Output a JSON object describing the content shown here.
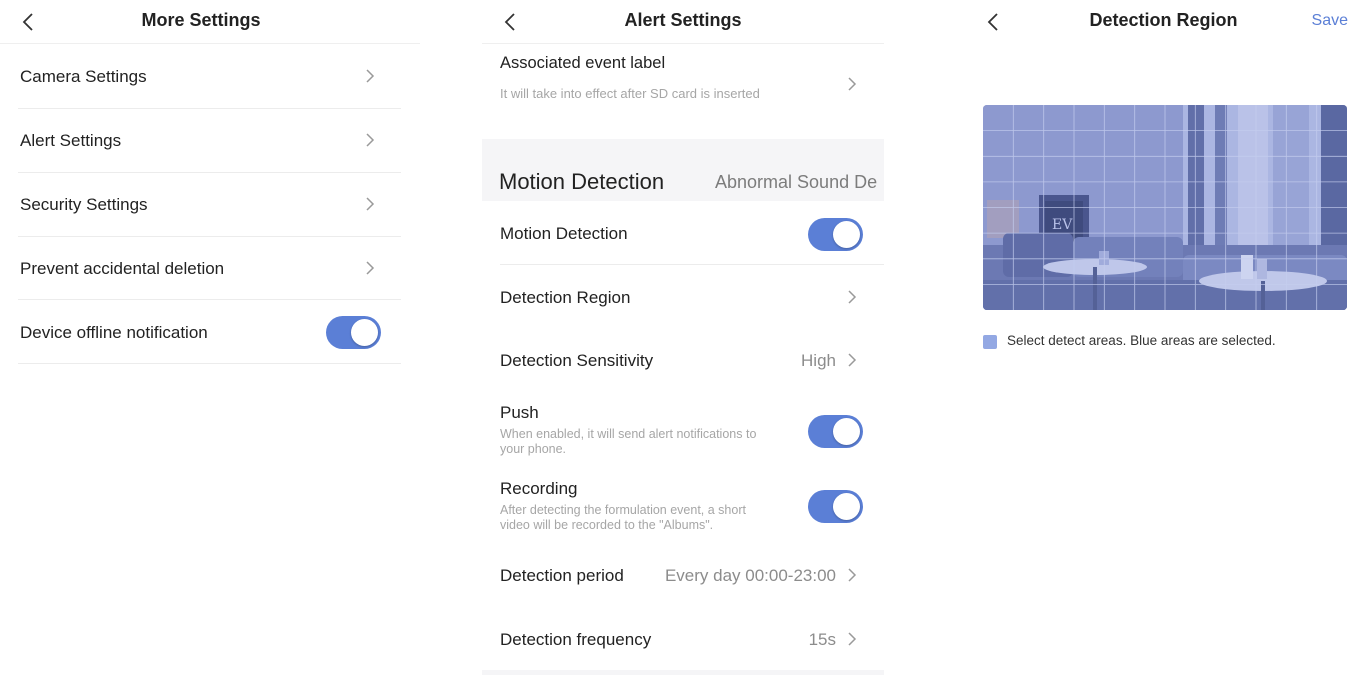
{
  "colors": {
    "accent": "#5b7fd6",
    "selected_area": "#93a8e3"
  },
  "more_settings": {
    "title": "More Settings",
    "items": [
      {
        "label": "Camera Settings"
      },
      {
        "label": "Alert Settings"
      },
      {
        "label": "Security Settings"
      },
      {
        "label": "Prevent accidental deletion"
      },
      {
        "label": "Device offline notification",
        "toggle_on": true
      }
    ]
  },
  "alert_settings": {
    "title": "Alert Settings",
    "associated_event": {
      "label": "Associated event label",
      "sub": "It will take into effect after SD card is inserted"
    },
    "tabs": {
      "active": "Motion Detection",
      "inactive": "Abnormal Sound De"
    },
    "motion_detection": {
      "label": "Motion Detection",
      "toggle_on": true
    },
    "detection_region": {
      "label": "Detection Region"
    },
    "detection_sensitivity": {
      "label": "Detection Sensitivity",
      "value": "High"
    },
    "push": {
      "label": "Push",
      "sub_line1": "When enabled, it will send alert notifications to",
      "sub_line2": "your phone.",
      "toggle_on": true
    },
    "recording": {
      "label": "Recording",
      "sub_line1": "After detecting the formulation event, a short",
      "sub_line2": "video will be recorded to the \"Albums\".",
      "toggle_on": true
    },
    "detection_period": {
      "label": "Detection period",
      "value": "Every day 00:00-23:00"
    },
    "detection_frequency": {
      "label": "Detection frequency",
      "value": "15s"
    }
  },
  "detection_region_screen": {
    "title": "Detection Region",
    "save_label": "Save",
    "legend": "Select detect areas. Blue areas are selected.",
    "preview_poster_text": "EV"
  }
}
